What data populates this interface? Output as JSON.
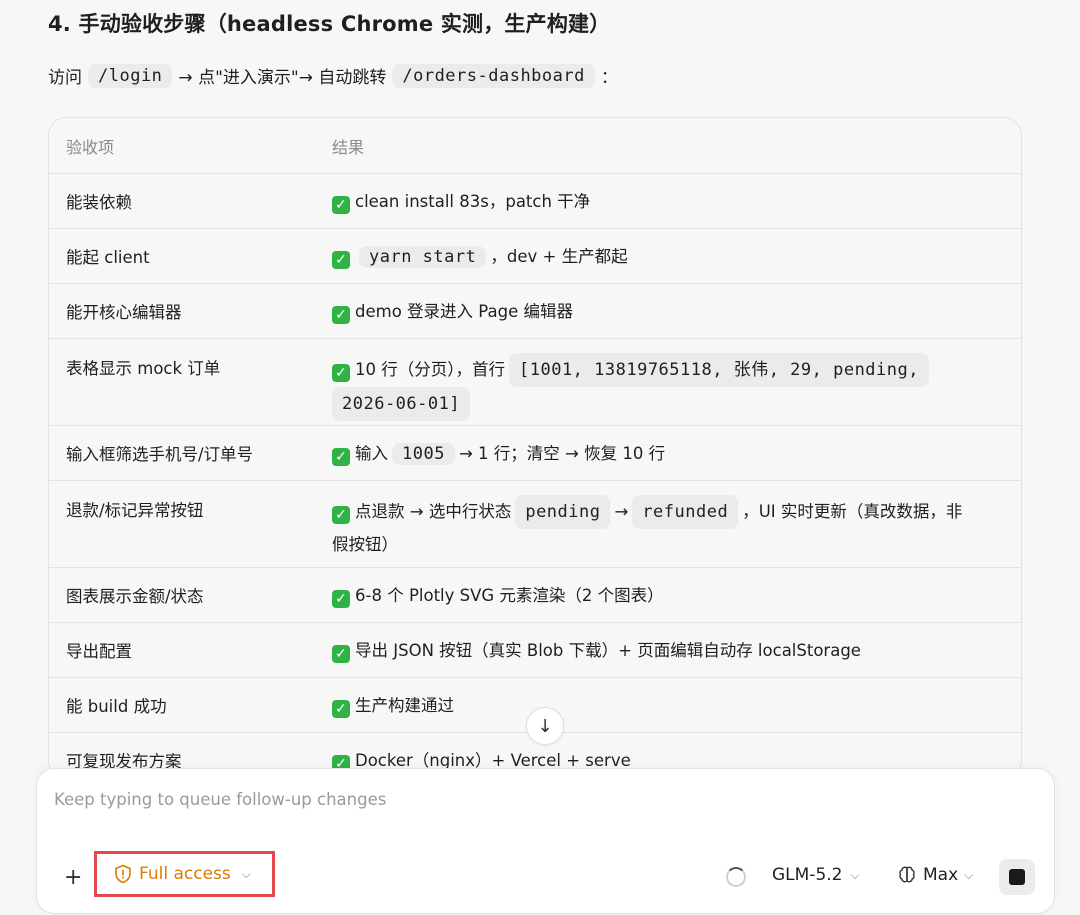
{
  "heading": "4. 手动验收步骤（headless Chrome 实测，生产构建）",
  "intro": {
    "prefix": "访问",
    "path1": "/login",
    "middle": "→ 点\"进入演示\"→ 自动跳转",
    "path2": "/orders-dashboard",
    "suffix": "："
  },
  "table": {
    "headers": [
      "验收项",
      "结果"
    ],
    "rows": [
      {
        "item": "能装依赖",
        "result": "clean install 83s，patch 干净"
      },
      {
        "item": "能起 client",
        "code": "yarn start",
        "result_after": "，dev + 生产都起"
      },
      {
        "item": "能开核心编辑器",
        "result": "demo 登录进入 Page 编辑器"
      },
      {
        "item": "表格显示 mock 订单",
        "result_before": "10 行（分页），首行",
        "code": "[1001, 13819765118, 张伟, 29, pending,",
        "code2": "2026-06-01]"
      },
      {
        "item": "输入框筛选手机号/订单号",
        "result_before": "输入",
        "code": "1005",
        "result_after": "→ 1 行；清空 → 恢复 10 行"
      },
      {
        "item": "退款/标记异常按钮",
        "result_before": "点退款 → 选中行状态",
        "code": "pending",
        "arrow": "→",
        "code2": "refunded",
        "result_after": "，UI 实时更新（真改数据，非",
        "result_line2": "假按钮）"
      },
      {
        "item": "图表展示金额/状态",
        "result": "6-8 个 Plotly SVG 元素渲染（2 个图表）"
      },
      {
        "item": "导出配置",
        "result": "导出 JSON 按钮（真实 Blob 下载）+ 页面编辑自动存 localStorage"
      },
      {
        "item": "能 build 成功",
        "result": "生产构建通过"
      },
      {
        "item": "可复现发布方案",
        "result": "Docker（nginx）+ Vercel + serve"
      }
    ]
  },
  "composer": {
    "placeholder": "Keep typing to queue follow-up changes",
    "plus": "+",
    "access_label": "Full access",
    "model_label": "GLM-5.2",
    "effort_label": "Max"
  },
  "colors": {
    "check": "#2fb344",
    "access": "#dd7a00",
    "highlight": "#e5484d"
  }
}
